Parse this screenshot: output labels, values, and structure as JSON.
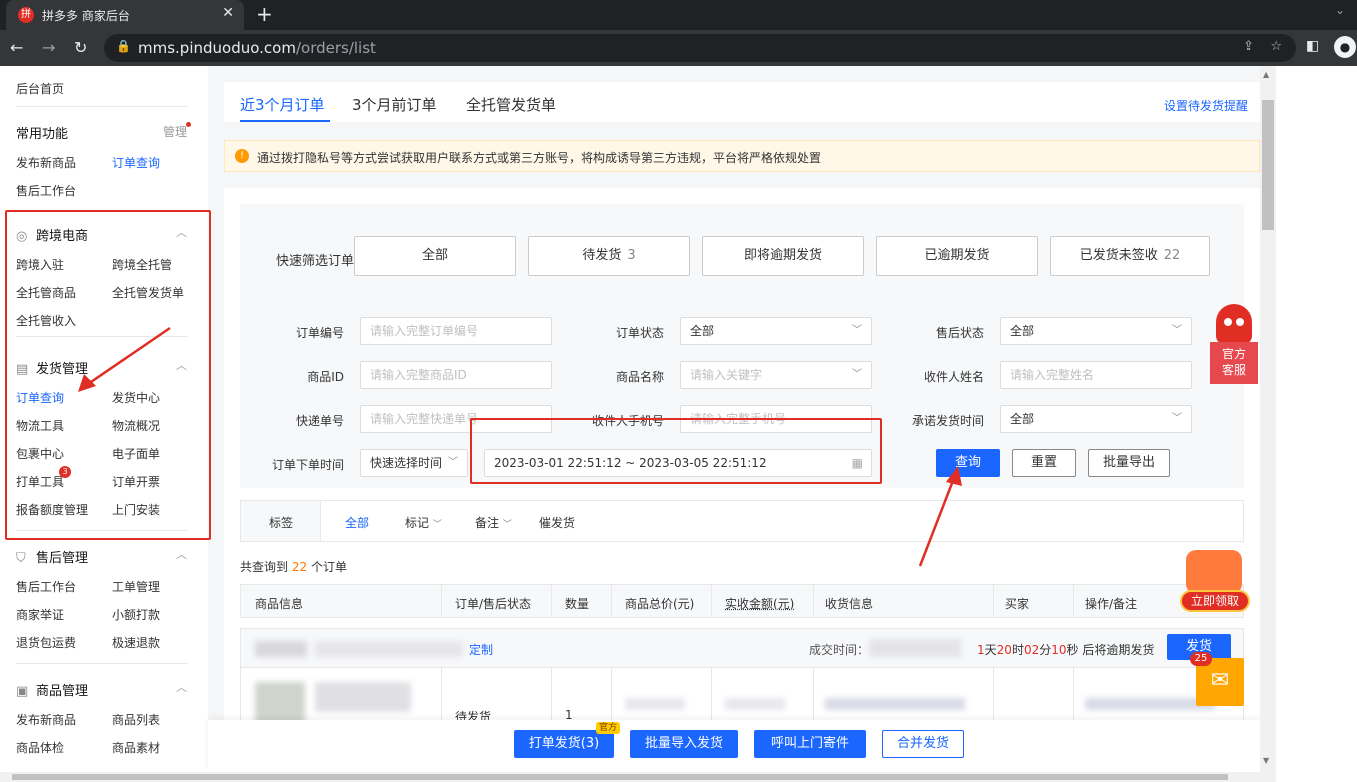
{
  "browser": {
    "tab_title": "拼多多 商家后台",
    "favicon": "拼",
    "url_host": "mms.pinduoduo.com",
    "url_path": "/orders/list"
  },
  "sidebar": {
    "home": "后台首页",
    "common": {
      "title": "常用功能",
      "manage": "管理",
      "items": [
        "发布新商品",
        "订单查询",
        "售后工作台"
      ]
    },
    "crossborder": {
      "title": "跨境电商",
      "items": [
        "跨境入驻",
        "跨境全托管",
        "全托管商品",
        "全托管发货单",
        "全托管收入"
      ]
    },
    "shipping": {
      "title": "发货管理",
      "items": [
        "订单查询",
        "发货中心",
        "物流工具",
        "物流概况",
        "包裹中心",
        "电子面单",
        "打单工具",
        "订单开票",
        "报备额度管理",
        "上门安装"
      ],
      "badge": "3"
    },
    "aftersale": {
      "title": "售后管理",
      "items": [
        "售后工作台",
        "工单管理",
        "商家举证",
        "小额打款",
        "退货包运费",
        "极速退款"
      ]
    },
    "goods": {
      "title": "商品管理",
      "items": [
        "发布新商品",
        "商品列表",
        "商品体检",
        "商品素材"
      ]
    }
  },
  "tabs": {
    "items": [
      "近3个月订单",
      "3个月前订单",
      "全托管发货单"
    ],
    "reminder_link": "设置待发货提醒"
  },
  "notice": "通过拨打隐私号等方式尝试获取用户联系方式或第三方账号，将构成诱导第三方违规，平台将严格依规处置",
  "quick_filter": {
    "label": "快速筛选订单",
    "buttons": [
      {
        "label": "全部",
        "count": ""
      },
      {
        "label": "待发货",
        "count": "3"
      },
      {
        "label": "即将逾期发货",
        "count": ""
      },
      {
        "label": "已逾期发货",
        "count": ""
      },
      {
        "label": "已发货未签收",
        "count": "22"
      }
    ]
  },
  "form": {
    "order_no": {
      "label": "订单编号",
      "placeholder": "请输入完整订单编号"
    },
    "order_status": {
      "label": "订单状态",
      "value": "全部"
    },
    "aftersale_status": {
      "label": "售后状态",
      "value": "全部"
    },
    "goods_id": {
      "label": "商品ID",
      "placeholder": "请输入完整商品ID"
    },
    "goods_name": {
      "label": "商品名称",
      "placeholder": "请输入关键字"
    },
    "receiver_name": {
      "label": "收件人姓名",
      "placeholder": "请输入完整姓名"
    },
    "express_no": {
      "label": "快递单号",
      "placeholder": "请输入完整快递单号"
    },
    "receiver_phone": {
      "label": "收件人手机号",
      "placeholder": "请输入完整手机号"
    },
    "promise_time": {
      "label": "承诺发货时间",
      "value": "全部"
    },
    "order_time": {
      "label": "订单下单时间",
      "quick": "快速选择时间",
      "range": "2023-03-01 22:51:12 ~ 2023-03-05 22:51:12"
    },
    "query": "查询",
    "reset": "重置",
    "export": "批量导出"
  },
  "kefu": {
    "line1": "官方",
    "line2": "客服"
  },
  "tagbar": {
    "label": "标签",
    "items": [
      "全部",
      "标记",
      "备注",
      "催发货"
    ]
  },
  "result": {
    "prefix": "共查询到",
    "count": "22",
    "suffix": "个订单"
  },
  "table": {
    "headers": [
      "商品信息",
      "订单/售后状态",
      "数量",
      "商品总价(元)",
      "实收金额(元)",
      "收货信息",
      "买家",
      "操作/备注"
    ],
    "order": {
      "custom": "定制",
      "deal_time_label": "成交时间：",
      "countdown": {
        "d": "1",
        "d_unit": "天",
        "h": "20",
        "h_unit": "时",
        "m": "02",
        "m_unit": "分",
        "s": "10",
        "s_unit": "秒",
        "tail": "后将逾期发货"
      },
      "ship": "发货",
      "status": "待发货",
      "qty": "1"
    }
  },
  "bottom_bar": {
    "print_ship": "打单发货(3)",
    "official": "官方",
    "import_ship": "批量导入发货",
    "call_pickup": "呼叫上门寄件",
    "merge_ship": "合并发货"
  },
  "promo": {
    "label": "立即领取"
  },
  "mail": {
    "badge": "25"
  },
  "colors": {
    "accent": "#1a66ff",
    "brand": "#e02e24",
    "annotation": "#e02e24"
  }
}
